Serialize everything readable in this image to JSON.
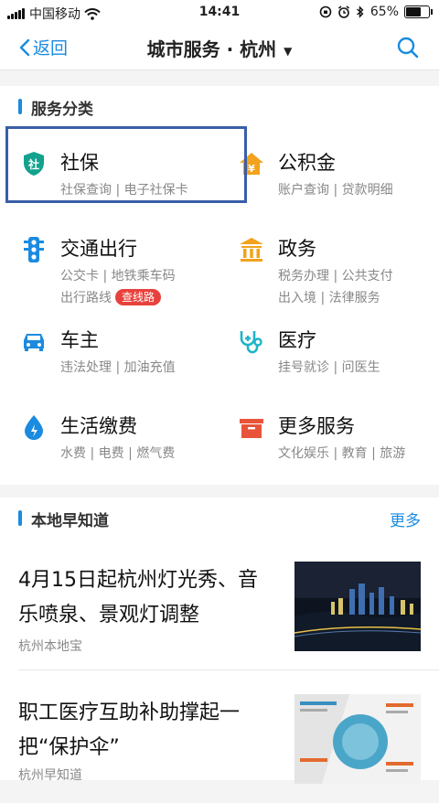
{
  "status": {
    "carrier": "中国移动",
    "time": "14:41",
    "battery": "65%",
    "battery_level": 0.65
  },
  "nav": {
    "back_label": "返回",
    "title": "城市服务 · 杭州"
  },
  "services": {
    "heading": "服务分类",
    "items": [
      {
        "name": "社保",
        "sub": "社保查询 | 电子社保卡"
      },
      {
        "name": "公积金",
        "sub": "账户查询 | 贷款明细"
      },
      {
        "name": "交通出行",
        "sub": "公交卡 | 地铁乘车码",
        "sub2": "出行路线",
        "tag": "查线路"
      },
      {
        "name": "政务",
        "sub": "税务办理 | 公共支付",
        "sub2": "出入境 | 法律服务"
      },
      {
        "name": "车主",
        "sub": "违法处理 | 加油充值"
      },
      {
        "name": "医疗",
        "sub": "挂号就诊 | 问医生"
      },
      {
        "name": "生活缴费",
        "sub": "水费 | 电费 | 燃气费"
      },
      {
        "name": "更多服务",
        "sub": "文化娱乐 | 教育 | 旅游"
      }
    ],
    "shebao_icon_char": "社"
  },
  "local": {
    "heading": "本地早知道",
    "more": "更多",
    "news": [
      {
        "title": "4月15日起杭州灯光秀、音乐喷泉、景观灯调整",
        "source": "杭州本地宝"
      },
      {
        "title": "职工医疗互助补助撑起一把“保护伞”",
        "source": "杭州早知道"
      }
    ]
  },
  "colors": {
    "accent": "#1a8be0",
    "tag": "#e8413c",
    "highlight": "#3a5ea8"
  }
}
